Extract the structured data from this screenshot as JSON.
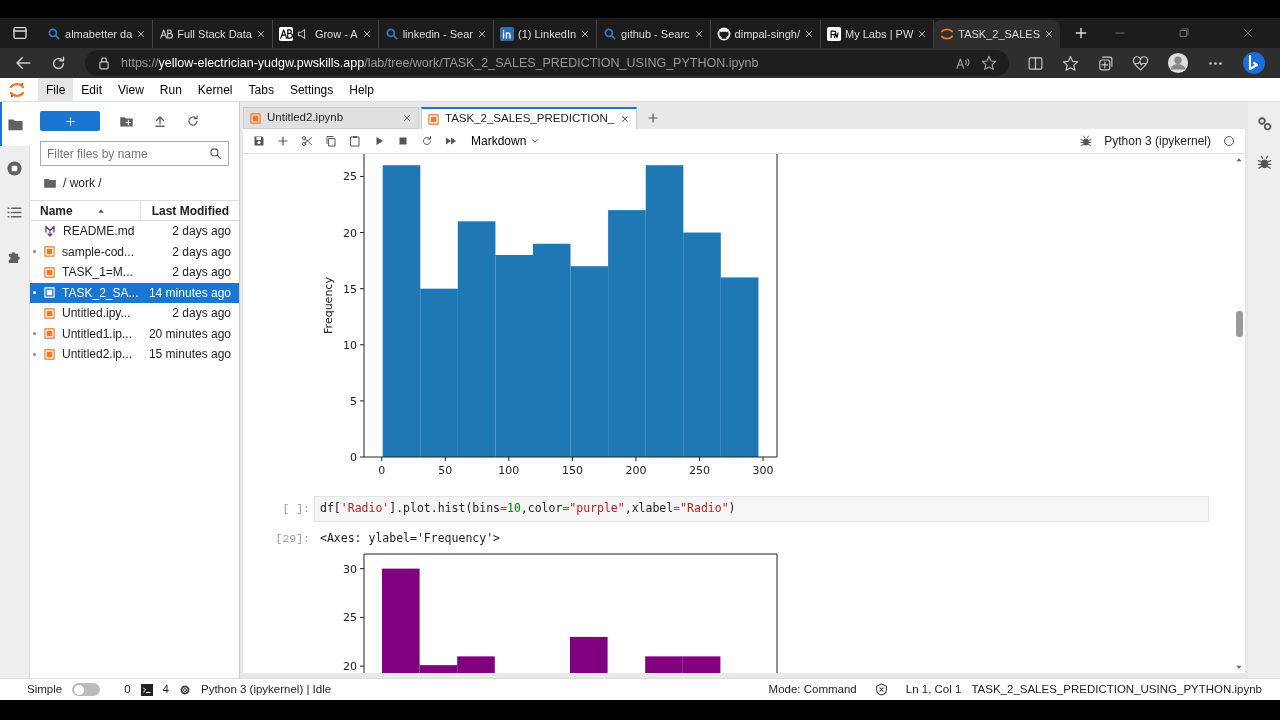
{
  "browser": {
    "tabs": [
      {
        "label": "almabetter da",
        "kind": "search",
        "audio": false,
        "selected": false
      },
      {
        "label": "Full Stack Data",
        "kind": "ab",
        "audio": false,
        "selected": false
      },
      {
        "label": "Grow - A",
        "kind": "abdark",
        "audio": true,
        "selected": false
      },
      {
        "label": "linkedin - Sear",
        "kind": "search",
        "audio": false,
        "selected": false
      },
      {
        "label": "(1) LinkedIn",
        "kind": "linkedin",
        "audio": false,
        "selected": false
      },
      {
        "label": "github - Searc",
        "kind": "search",
        "audio": false,
        "selected": false
      },
      {
        "label": "dimpal-singh/",
        "kind": "github",
        "audio": false,
        "selected": false
      },
      {
        "label": "My Labs | PW",
        "kind": "pw",
        "audio": false,
        "selected": false
      },
      {
        "label": "TASK_2_SALES",
        "kind": "jupyter",
        "audio": false,
        "selected": true
      }
    ],
    "url": {
      "scheme": "https://",
      "host": "yellow-electrician-yudgw.pwskills.app",
      "path": "/lab/tree/work/TASK_2_SALES_PREDICTION_USING_PYTHON.ipynb"
    }
  },
  "menubar": [
    {
      "label": "File",
      "selected": true
    },
    {
      "label": "Edit",
      "selected": false
    },
    {
      "label": "View",
      "selected": false
    },
    {
      "label": "Run",
      "selected": false
    },
    {
      "label": "Kernel",
      "selected": false
    },
    {
      "label": "Tabs",
      "selected": false
    },
    {
      "label": "Settings",
      "selected": false
    },
    {
      "label": "Help",
      "selected": false
    }
  ],
  "activity_bar": [
    {
      "selected": true
    },
    {
      "selected": false
    },
    {
      "selected": false
    },
    {
      "selected": false
    }
  ],
  "file_browser": {
    "placeholder": "Filter files by name",
    "path": "/ work /",
    "columns": [
      "Name",
      "Last Modified"
    ],
    "files": [
      {
        "name": "README.md",
        "modified": "2 days ago",
        "kind": "markdown",
        "running": false,
        "selected": false
      },
      {
        "name": "sample-cod...",
        "modified": "2 days ago",
        "kind": "notebook",
        "running": true,
        "selected": false
      },
      {
        "name": "TASK_1=M...",
        "modified": "2 days ago",
        "kind": "notebook",
        "running": false,
        "selected": false
      },
      {
        "name": "TASK_2_SA...",
        "modified": "14 minutes ago",
        "kind": "notebook",
        "running": true,
        "selected": true
      },
      {
        "name": "Untitled.ipy...",
        "modified": "2 days ago",
        "kind": "notebook",
        "running": false,
        "selected": false
      },
      {
        "name": "Untitled1.ip...",
        "modified": "20 minutes ago",
        "kind": "notebook",
        "running": true,
        "selected": false
      },
      {
        "name": "Untitled2.ip...",
        "modified": "15 minutes ago",
        "kind": "notebook",
        "running": true,
        "selected": false
      }
    ]
  },
  "notebook": {
    "tabs": [
      {
        "label": "Untitled2.ipynb",
        "selected": false
      },
      {
        "label": "TASK_2_SALES_PREDICTION_",
        "selected": true
      }
    ],
    "cell_type": "Markdown",
    "kernel": "Python 3 (ipykernel)",
    "kernel_busy": false,
    "cells": [
      {
        "kind": "chart",
        "chart_data": {
          "type": "bar",
          "ylabel": "Frequency",
          "x": [
            15.5,
            45.1,
            74.6,
            104.2,
            133.7,
            163.3,
            192.9,
            222.5,
            252.0,
            281.6
          ],
          "series": [
            {
              "color": "#1f77b4",
              "values": [
                26,
                15,
                21,
                18,
                19,
                17,
                22,
                26,
                20,
                16
              ]
            }
          ],
          "xlim": [
            -14,
            311
          ],
          "ylim": [
            0,
            27
          ],
          "xticks": [
            0,
            50,
            100,
            150,
            200,
            250,
            300
          ],
          "yticks": [
            0,
            5,
            10,
            15,
            20,
            25
          ]
        }
      },
      {
        "kind": "code",
        "prompt": "[ ]:",
        "code": "df['Radio'].plot.hist(bins=10,color=\"purple\",xlabel=\"Radio\")"
      },
      {
        "kind": "output",
        "prompt": "[29]:",
        "text": "<Axes: ylabel='Frequency'>"
      },
      {
        "kind": "chart",
        "chart_data": {
          "type": "bar",
          "series": [
            {
              "color": "#800080",
              "values": [
                30,
                20.1,
                21,
                null,
                null,
                23,
                null,
                21,
                21,
                null
              ]
            }
          ],
          "ylim": [
            19.5,
            31.5
          ],
          "yticks": [
            20,
            25,
            30
          ]
        }
      }
    ]
  },
  "status_bar": {
    "simple_label": "Simple",
    "simple_mode": false,
    "terminals": "0",
    "kernels": "4",
    "kernel_status": "Python 3 (ipykernel) | Idle",
    "mode": "Mode: Command",
    "position": "Ln 1, Col 1",
    "file": "TASK_2_SALES_PREDICTION_USING_PYTHON.ipynb"
  }
}
